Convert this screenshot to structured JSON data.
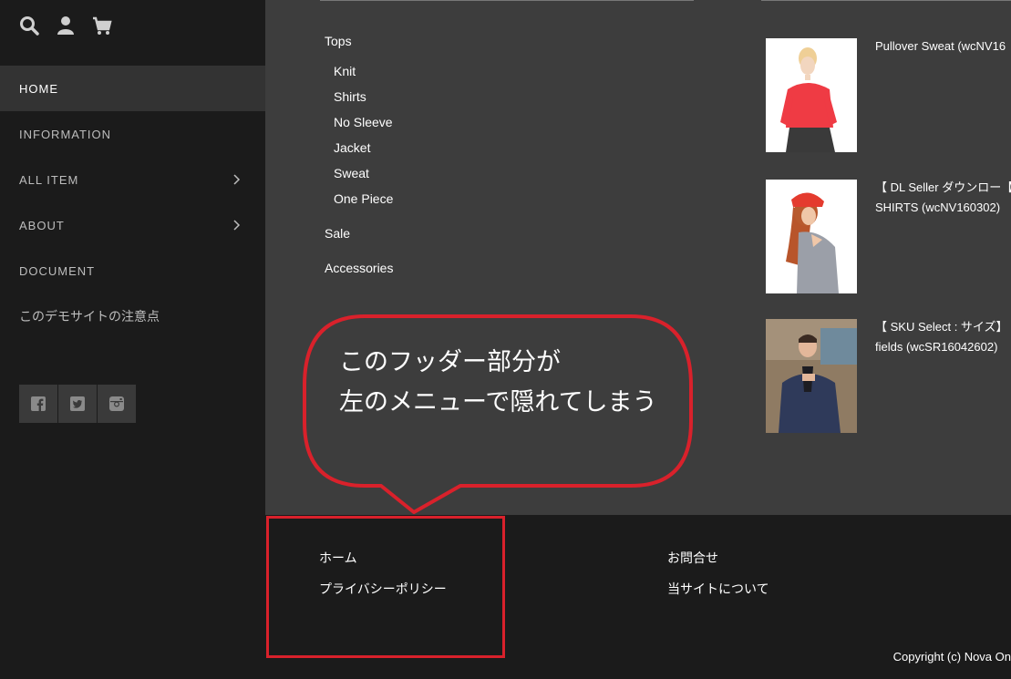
{
  "sidebar": {
    "icons": [
      "search-icon",
      "user-icon",
      "cart-icon"
    ],
    "menu": [
      {
        "label": "HOME",
        "active": true
      },
      {
        "label": "INFORMATION"
      },
      {
        "label": "ALL ITEM",
        "has_submenu": true
      },
      {
        "label": "ABOUT",
        "has_submenu": true
      },
      {
        "label": "DOCUMENT"
      },
      {
        "label": "このデモサイトの注意点"
      }
    ],
    "social": [
      "facebook-icon",
      "twitter-icon",
      "instagram-icon"
    ]
  },
  "categories": {
    "top": "Tops",
    "sub": [
      "Knit",
      "Shirts",
      "No Sleeve",
      "Jacket",
      "Sweat",
      "One Piece"
    ],
    "others": [
      "Sale",
      "Accessories"
    ]
  },
  "products": [
    {
      "title_line1": "Pullover Sweat (wcNV16",
      "title_line2": ""
    },
    {
      "title_line1": "【 DL Seller ダウンロー【",
      "title_line2": "SHIRTS (wcNV160302)"
    },
    {
      "title_line1": "【 SKU Select : サイズ】",
      "title_line2": "fields (wcSR16042602)"
    }
  ],
  "annotation": {
    "line1": "このフッダー部分が",
    "line2": "左のメニューで隠れてしまう",
    "color": "#d9212b"
  },
  "footer": {
    "links_left": [
      "ホーム",
      "プライバシーポリシー"
    ],
    "links_right": [
      "お問合せ",
      "当サイトについて"
    ],
    "copyright": "Copyright (c) Nova On"
  }
}
